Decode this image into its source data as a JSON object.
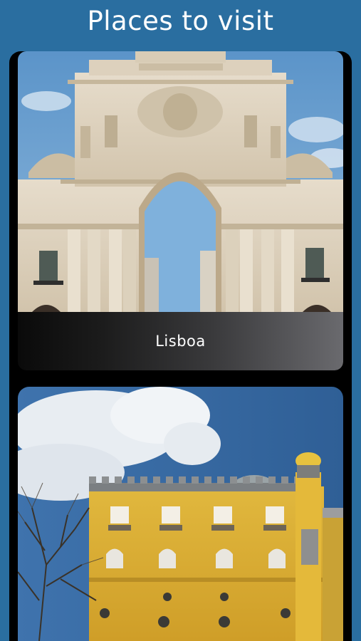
{
  "header": {
    "title": "Places to visit"
  },
  "places": [
    {
      "name": "Lisboa",
      "image": "arch-photo"
    },
    {
      "name": "",
      "image": "palace-photo"
    }
  ],
  "colors": {
    "background": "#2a6ea0",
    "panel": "#000000",
    "text": "#ffffff"
  }
}
